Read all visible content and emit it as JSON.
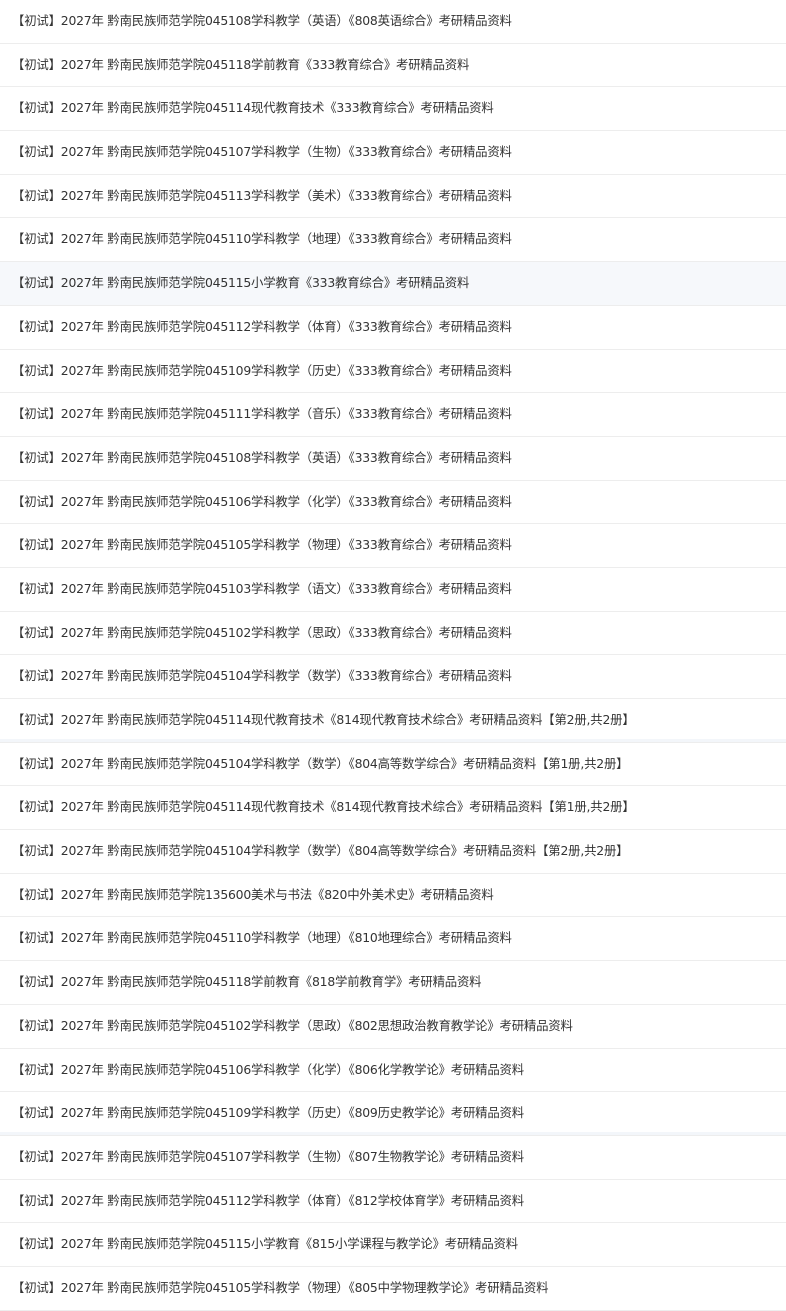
{
  "items": [
    {
      "title": "【初试】2027年 黔南民族师范学院045108学科教学（英语）《808英语综合》考研精品资料",
      "style": ""
    },
    {
      "title": "【初试】2027年 黔南民族师范学院045118学前教育《333教育综合》考研精品资料",
      "style": ""
    },
    {
      "title": "【初试】2027年 黔南民族师范学院045114现代教育技术《333教育综合》考研精品资料",
      "style": ""
    },
    {
      "title": "【初试】2027年 黔南民族师范学院045107学科教学（生物）《333教育综合》考研精品资料",
      "style": ""
    },
    {
      "title": "【初试】2027年 黔南民族师范学院045113学科教学（美术）《333教育综合》考研精品资料",
      "style": ""
    },
    {
      "title": "【初试】2027年 黔南民族师范学院045110学科教学（地理）《333教育综合》考研精品资料",
      "style": ""
    },
    {
      "title": "【初试】2027年 黔南民族师范学院045115小学教育《333教育综合》考研精品资料",
      "style": "shaded"
    },
    {
      "title": "【初试】2027年 黔南民族师范学院045112学科教学（体育）《333教育综合》考研精品资料",
      "style": ""
    },
    {
      "title": "【初试】2027年 黔南民族师范学院045109学科教学（历史）《333教育综合》考研精品资料",
      "style": ""
    },
    {
      "title": "【初试】2027年 黔南民族师范学院045111学科教学（音乐）《333教育综合》考研精品资料",
      "style": ""
    },
    {
      "title": "【初试】2027年 黔南民族师范学院045108学科教学（英语）《333教育综合》考研精品资料",
      "style": ""
    },
    {
      "title": "【初试】2027年 黔南民族师范学院045106学科教学（化学）《333教育综合》考研精品资料",
      "style": ""
    },
    {
      "title": "【初试】2027年 黔南民族师范学院045105学科教学（物理）《333教育综合》考研精品资料",
      "style": ""
    },
    {
      "title": "【初试】2027年 黔南民族师范学院045103学科教学（语文）《333教育综合》考研精品资料",
      "style": ""
    },
    {
      "title": "【初试】2027年 黔南民族师范学院045102学科教学（思政）《333教育综合》考研精品资料",
      "style": ""
    },
    {
      "title": "【初试】2027年 黔南民族师范学院045104学科教学（数学）《333教育综合》考研精品资料",
      "style": ""
    },
    {
      "title": "【初试】2027年 黔南民族师范学院045114现代教育技术《814现代教育技术综合》考研精品资料【第2册,共2册】",
      "style": "stripe"
    },
    {
      "title": "【初试】2027年 黔南民族师范学院045104学科教学（数学）《804高等数学综合》考研精品资料【第1册,共2册】",
      "style": ""
    },
    {
      "title": "【初试】2027年 黔南民族师范学院045114现代教育技术《814现代教育技术综合》考研精品资料【第1册,共2册】",
      "style": ""
    },
    {
      "title": "【初试】2027年 黔南民族师范学院045104学科教学（数学）《804高等数学综合》考研精品资料【第2册,共2册】",
      "style": ""
    },
    {
      "title": "【初试】2027年 黔南民族师范学院135600美术与书法《820中外美术史》考研精品资料",
      "style": ""
    },
    {
      "title": "【初试】2027年 黔南民族师范学院045110学科教学（地理）《810地理综合》考研精品资料",
      "style": ""
    },
    {
      "title": "【初试】2027年 黔南民族师范学院045118学前教育《818学前教育学》考研精品资料",
      "style": ""
    },
    {
      "title": "【初试】2027年 黔南民族师范学院045102学科教学（思政）《802思想政治教育教学论》考研精品资料",
      "style": ""
    },
    {
      "title": "【初试】2027年 黔南民族师范学院045106学科教学（化学）《806化学教学论》考研精品资料",
      "style": ""
    },
    {
      "title": "【初试】2027年 黔南民族师范学院045109学科教学（历史）《809历史教学论》考研精品资料",
      "style": "stripe"
    },
    {
      "title": "【初试】2027年 黔南民族师范学院045107学科教学（生物）《807生物教学论》考研精品资料",
      "style": ""
    },
    {
      "title": "【初试】2027年 黔南民族师范学院045112学科教学（体育）《812学校体育学》考研精品资料",
      "style": ""
    },
    {
      "title": "【初试】2027年 黔南民族师范学院045115小学教育《815小学课程与教学论》考研精品资料",
      "style": ""
    },
    {
      "title": "【初试】2027年 黔南民族师范学院045105学科教学（物理）《805中学物理教学论》考研精品资料",
      "style": ""
    }
  ]
}
